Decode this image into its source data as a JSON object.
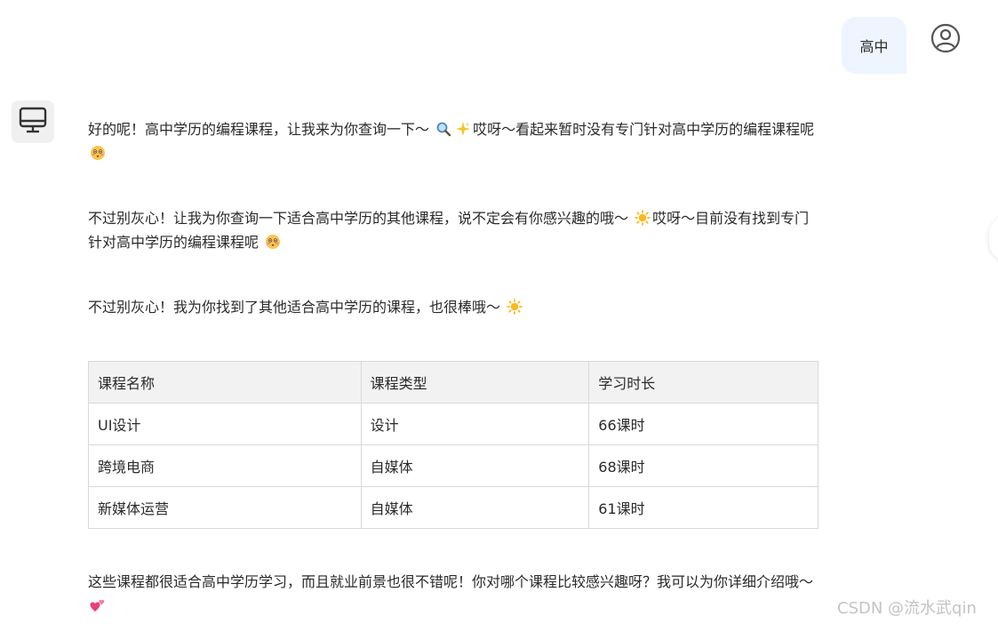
{
  "user_message": {
    "text": "高中"
  },
  "bot_message": {
    "paragraphs": [
      {
        "segments": [
          {
            "type": "text",
            "value": "好的呢！高中学历的编程课程，让我来为你查询一下～ "
          },
          {
            "type": "emoji",
            "name": "magnifier-emoji"
          },
          {
            "type": "emoji",
            "name": "sparkles-emoji"
          },
          {
            "type": "text",
            "value": "哎呀～看起来暂时没有专门针对高中学历的编程课程呢 "
          },
          {
            "type": "emoji",
            "name": "flushed-face-emoji"
          }
        ]
      },
      {
        "segments": [
          {
            "type": "text",
            "value": "不过别灰心！让我为你查询一下适合高中学历的其他课程，说不定会有你感兴趣的哦～ "
          },
          {
            "type": "emoji",
            "name": "sun-emoji"
          },
          {
            "type": "text",
            "value": "哎呀～目前没有找到专门针对高中学历的编程课程呢 "
          },
          {
            "type": "emoji",
            "name": "flushed-face-emoji"
          }
        ]
      },
      {
        "segments": [
          {
            "type": "text",
            "value": "不过别灰心！我为你找到了其他适合高中学历的课程，也很棒哦～ "
          },
          {
            "type": "emoji",
            "name": "sun-emoji"
          }
        ]
      },
      {
        "segments": [
          {
            "type": "text",
            "value": "这些课程都很适合高中学历学习，而且就业前景也很不错呢！你对哪个课程比较感兴趣呀？我可以为你详细介绍哦～ "
          },
          {
            "type": "emoji",
            "name": "two-hearts-emoji"
          }
        ]
      }
    ],
    "table": {
      "headers": [
        "课程名称",
        "课程类型",
        "学习时长"
      ],
      "rows": [
        [
          "UI设计",
          "设计",
          "66课时"
        ],
        [
          "跨境电商",
          "自媒体",
          "68课时"
        ],
        [
          "新媒体运营",
          "自媒体",
          "61课时"
        ]
      ]
    }
  },
  "icons": {
    "user_avatar": "user-circle-icon",
    "bot_avatar": "monitor-icon"
  },
  "colors": {
    "user_bubble_bg": "#eef5ff",
    "table_header_bg": "#f2f2f2",
    "border": "#d9d9d9"
  },
  "watermark": "CSDN @流水武qin"
}
